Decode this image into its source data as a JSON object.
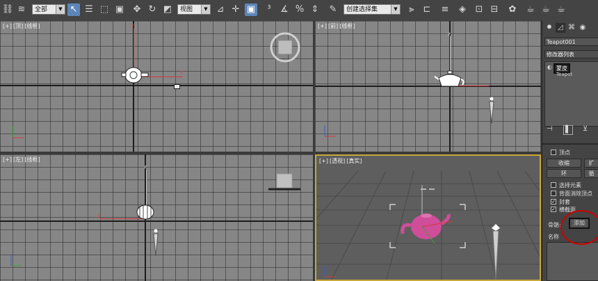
{
  "toolbar": {
    "filter_select": "全部",
    "ref_coord_select": "视图",
    "selection_set_select": "创建选择集",
    "icons": [
      "link-icon",
      "unlink-icon",
      "bind-icon",
      "select-object-icon",
      "select-by-name-icon",
      "rect-region-icon",
      "window-crossing-icon",
      "move-icon",
      "rotate-icon",
      "scale-icon",
      "pivot-icon",
      "select-manipulate-icon",
      "keyboard-shortcut-icon",
      "snap-icon",
      "angle-snap-icon",
      "percent-snap-icon",
      "spinner-snap-icon",
      "edit-named-sets-icon",
      "mirror-icon",
      "align-icon",
      "layer-icon",
      "graphite-icon",
      "curve-editor-icon",
      "schematic-view-icon",
      "material-editor-icon",
      "render-setup-icon",
      "rendered-frame-icon",
      "render-icon"
    ]
  },
  "viewports": {
    "top": {
      "plus": "[+]",
      "name": "[顶]",
      "shading": "[线框]"
    },
    "front": {
      "plus": "[+]",
      "name": "[前]",
      "shading": "[线框]"
    },
    "left": {
      "plus": "[+]",
      "name": "[左]",
      "shading": "[线框]"
    },
    "persp": {
      "plus": "[+]",
      "name": "[透视]",
      "shading": "[真实]"
    }
  },
  "axis_labels": {
    "x": "x",
    "y": "y",
    "z": "z"
  },
  "colors": {
    "accent_yellow": "#c8a83a",
    "axis_red": "#d03a3a",
    "axis_green": "#3aa33a",
    "axis_blue": "#3a5ad0",
    "teapot_pink": "#d04d9a",
    "highlight_red": "#d00000"
  },
  "panel": {
    "tabs": [
      "create-icon",
      "modify-icon",
      "hierarchy-icon",
      "motion-icon"
    ],
    "object_name": "Teapot001",
    "modifier_list": "修改器列表",
    "stack_item_selected": "蒙皮",
    "stack_item_base": "Teapot",
    "sel_vertex_label": "顶点",
    "btn_shrink": "收缩",
    "btn_grow": "扩",
    "btn_ring": "环",
    "btn_loop": "循",
    "cb_select_element": "选择元素",
    "cb_backface": "背面消除顶点",
    "cb_envelope": "封套",
    "cb_crosssection": "横截面",
    "bones_label": "骨骼:",
    "add_button": "添加",
    "name_label": "名称"
  }
}
